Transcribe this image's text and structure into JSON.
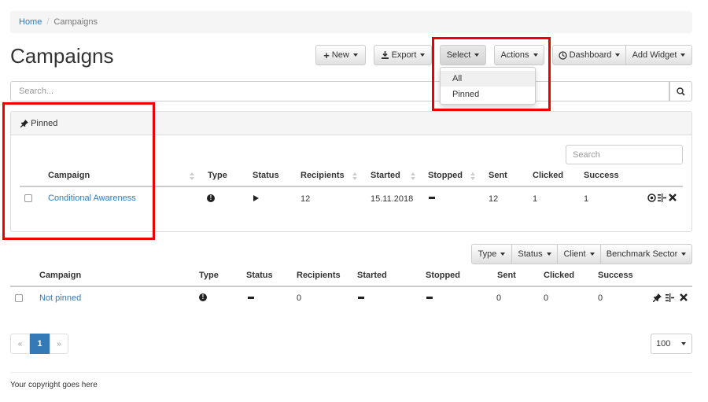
{
  "breadcrumb": {
    "home": "Home",
    "separator": "/",
    "current": "Campaigns"
  },
  "page": {
    "title": "Campaigns"
  },
  "toolbar": {
    "new_label": "New",
    "export_label": "Export",
    "select_label": "Select",
    "actions_label": "Actions",
    "dashboard_label": "Dashboard",
    "add_widget_label": "Add Widget"
  },
  "select_menu": {
    "items": [
      "All",
      "Pinned"
    ]
  },
  "search": {
    "placeholder": "Search..."
  },
  "pinned_panel": {
    "heading": "Pinned",
    "search_placeholder": "Search",
    "columns": [
      "Campaign",
      "Type",
      "Status",
      "Recipients",
      "Started",
      "Stopped",
      "Sent",
      "Clicked",
      "Success"
    ],
    "rows": [
      {
        "campaign": "Conditional Awareness",
        "type_icon": "exclamation-circle-icon",
        "status_icon": "play-icon",
        "recipients": "12",
        "started": "15.11.2018",
        "stopped_icon": "dash-icon",
        "sent": "12",
        "clicked": "1",
        "success": "1"
      }
    ]
  },
  "filters": {
    "type": "Type",
    "status": "Status",
    "client": "Client",
    "benchmark": "Benchmark Sector"
  },
  "main_table": {
    "columns": [
      "Campaign",
      "Type",
      "Status",
      "Recipients",
      "Started",
      "Stopped",
      "Sent",
      "Clicked",
      "Success"
    ],
    "rows": [
      {
        "campaign": "Not pinned",
        "type_icon": "exclamation-circle-icon",
        "status_icon": "dash-icon",
        "recipients": "0",
        "started_icon": "dash-icon",
        "stopped_icon": "dash-icon",
        "sent": "0",
        "clicked": "0",
        "success": "0"
      }
    ]
  },
  "pagination": {
    "prev": "«",
    "current": "1",
    "next": "»"
  },
  "page_size": {
    "value": "100"
  },
  "footer": {
    "text": "Your copyright goes here"
  },
  "colors": {
    "link": "#337ab7",
    "highlight": "#e00000",
    "active_page": "#337ab7"
  }
}
